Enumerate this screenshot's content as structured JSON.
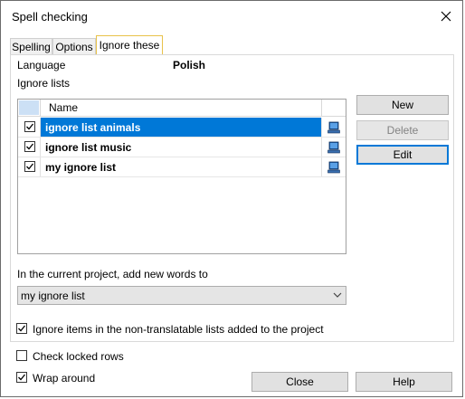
{
  "window": {
    "title": "Spell checking"
  },
  "tabs": [
    {
      "label": "Spelling"
    },
    {
      "label": "Options"
    },
    {
      "label": "Ignore these"
    }
  ],
  "language": {
    "label": "Language",
    "value": "Polish"
  },
  "ignore_lists": {
    "label": "Ignore lists",
    "column_header": "Name",
    "rows": [
      {
        "name": "ignore list animals",
        "checked": true,
        "selected": true,
        "icon": "computer-icon"
      },
      {
        "name": "ignore list music",
        "checked": true,
        "selected": false,
        "icon": "computer-icon"
      },
      {
        "name": "my ignore list",
        "checked": true,
        "selected": false,
        "icon": "computer-icon"
      }
    ]
  },
  "buttons": {
    "new": "New",
    "delete": "Delete",
    "edit": "Edit",
    "close": "Close",
    "help": "Help"
  },
  "add_words": {
    "label": "In the current project, add new words to",
    "selected": "my ignore list"
  },
  "checkboxes": {
    "ignore_nontranslatable": {
      "label": "Ignore items in the non-translatable lists added to the project",
      "checked": true
    },
    "check_locked_rows": {
      "label": "Check locked rows",
      "checked": false
    },
    "wrap_around": {
      "label": "Wrap around",
      "checked": true
    }
  },
  "colors": {
    "selection": "#0078d7",
    "active_tab_border": "#e8c24a"
  }
}
